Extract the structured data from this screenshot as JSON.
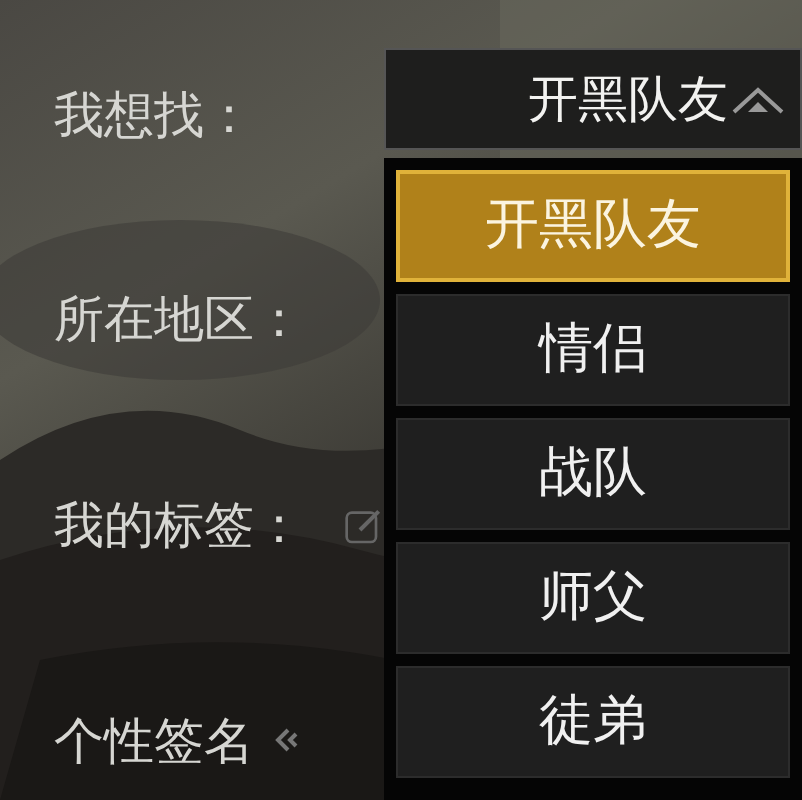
{
  "fields": [
    {
      "label": "我想找：",
      "kind": "dropdown"
    },
    {
      "label": "所在地区：",
      "kind": "dropdown"
    },
    {
      "label": "我的标签：",
      "kind": "tags"
    },
    {
      "label": "个性签名",
      "kind": "signature"
    }
  ],
  "dropdown": {
    "value": "开黑队友",
    "expanded": true
  },
  "options": [
    {
      "label": "开黑队友",
      "selected": true
    },
    {
      "label": "情侣",
      "selected": false
    },
    {
      "label": "战队",
      "selected": false
    },
    {
      "label": "师父",
      "selected": false
    },
    {
      "label": "徒弟",
      "selected": false
    }
  ]
}
